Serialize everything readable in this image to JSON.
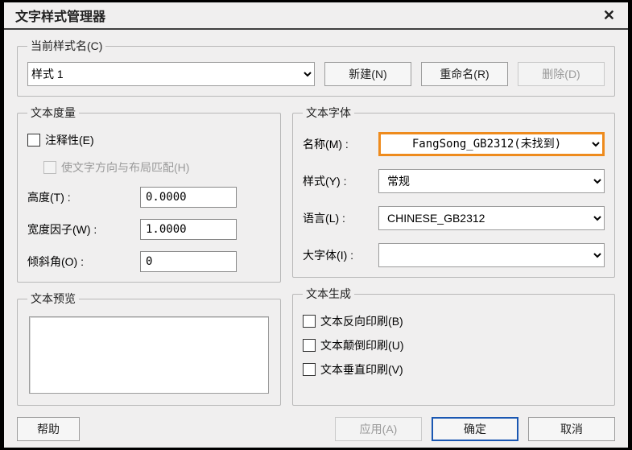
{
  "title": "文字样式管理器",
  "currentStyle": {
    "legend": "当前样式名(C)",
    "value": "样式 1",
    "buttons": {
      "new": "新建(N)",
      "rename": "重命名(R)",
      "delete": "删除(D)"
    }
  },
  "metrics": {
    "legend": "文本度量",
    "annotative": "注释性(E)",
    "matchOrient": "使文字方向与布局匹配(H)",
    "heightLabel": "高度(T) :",
    "heightValue": "0.0000",
    "widthFactorLabel": "宽度因子(W) :",
    "widthFactorValue": "1.0000",
    "obliqueLabel": "倾斜角(O) :",
    "obliqueValue": "0"
  },
  "font": {
    "legend": "文本字体",
    "nameLabel": "名称(M) :",
    "nameValue": "FangSong_GB2312(未找到)",
    "styleLabel": "样式(Y) :",
    "styleValue": "常规",
    "langLabel": "语言(L) :",
    "langValue": "CHINESE_GB2312",
    "bigfontLabel": "大字体(I) :",
    "bigfontValue": ""
  },
  "preview": {
    "legend": "文本预览"
  },
  "generation": {
    "legend": "文本生成",
    "backwards": "文本反向印刷(B)",
    "upsidedown": "文本颠倒印刷(U)",
    "vertical": "文本垂直印刷(V)"
  },
  "bottom": {
    "help": "帮助",
    "apply": "应用(A)",
    "ok": "确定",
    "cancel": "取消"
  },
  "colors": {
    "highlight": "#ee8b1d",
    "defaultBtnBorder": "#1a57b2"
  }
}
